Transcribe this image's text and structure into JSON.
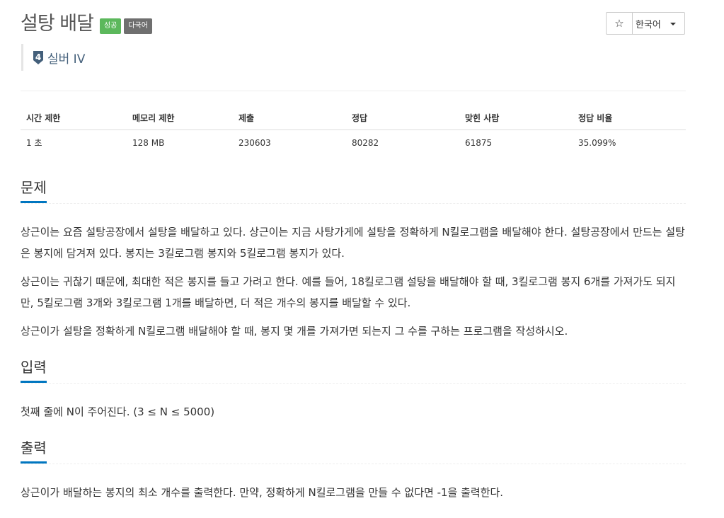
{
  "problem": {
    "title": "설탕 배달",
    "labels": {
      "status": "성공",
      "multilang": "다국어"
    },
    "tier": {
      "number": "4",
      "name": "실버 IV",
      "color": "#435f7a"
    }
  },
  "toolbar": {
    "star_icon": "star-outline-icon",
    "star_glyph": "☆",
    "language": "한국어"
  },
  "info_table": {
    "headers": [
      "시간 제한",
      "메모리 제한",
      "제출",
      "정답",
      "맞힌 사람",
      "정답 비율"
    ],
    "values": [
      "1 초",
      "128 MB",
      "230603",
      "80282",
      "61875",
      "35.099%"
    ]
  },
  "sections": {
    "description": {
      "heading": "문제",
      "paragraphs": [
        "상근이는 요즘 설탕공장에서 설탕을 배달하고 있다. 상근이는 지금 사탕가게에 설탕을 정확하게 N킬로그램을 배달해야 한다. 설탕공장에서 만드는 설탕은 봉지에 담겨져 있다. 봉지는 3킬로그램 봉지와 5킬로그램 봉지가 있다.",
        "상근이는 귀찮기 때문에, 최대한 적은 봉지를 들고 가려고 한다. 예를 들어, 18킬로그램 설탕을 배달해야 할 때, 3킬로그램 봉지 6개를 가져가도 되지만, 5킬로그램 3개와 3킬로그램 1개를 배달하면, 더 적은 개수의 봉지를 배달할 수 있다.",
        "상근이가 설탕을 정확하게 N킬로그램 배달해야 할 때, 봉지 몇 개를 가져가면 되는지 그 수를 구하는 프로그램을 작성하시오."
      ]
    },
    "input": {
      "heading": "입력",
      "text": "첫째 줄에 N이 주어진다. (3 ≤ N ≤ 5000)"
    },
    "output": {
      "heading": "출력",
      "text": "상근이가 배달하는 봉지의 최소 개수를 출력한다. 만약, 정확하게 N킬로그램을 만들 수 없다면 -1을 출력한다."
    }
  },
  "colors": {
    "accent": "#0076c0",
    "success": "#5cb85c",
    "muted_label": "#6f6f6f"
  }
}
